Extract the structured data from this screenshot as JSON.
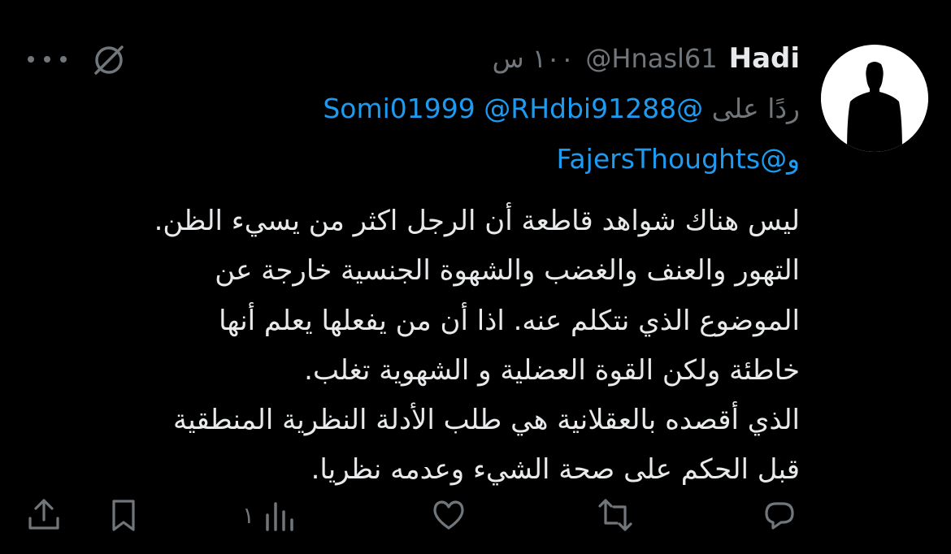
{
  "tweet": {
    "author_name": "Hadi",
    "author_handle": "@Hnasl61",
    "time": "١٠٠ س",
    "reply_label": "ردًا على",
    "mentions_line1": [
      "@Somi01999",
      "@RHdbi91288"
    ],
    "mentions_line2_prefix": "و",
    "mentions_line2": "@FajersThoughts",
    "body_lines": [
      "ليس هناك شواهد قاطعة أن الرجل اكثر من يسيء الظن.",
      "التهور والعنف والغضب والشهوة الجنسية خارجة عن",
      "الموضوع الذي نتكلم عنه. اذا أن من يفعلها يعلم أنها",
      "خاطئة ولكن القوة العضلية و الشهوية تغلب.",
      "الذي أقصده بالعقلانية هي طلب الأدلة النظرية المنطقية",
      "قبل الحكم على صحة الشيء وعدمه نظريا."
    ],
    "views_count": "١"
  },
  "colors": {
    "background": "#000000",
    "text": "#e7e9ea",
    "muted": "#71767b",
    "link": "#1d9bf0"
  },
  "icons": {
    "reply": "reply-icon",
    "repost": "repost-icon",
    "like": "heart-icon",
    "views": "views-icon",
    "bookmark": "bookmark-icon",
    "share": "share-icon",
    "grok": "grok-icon",
    "more": "more-icon"
  }
}
